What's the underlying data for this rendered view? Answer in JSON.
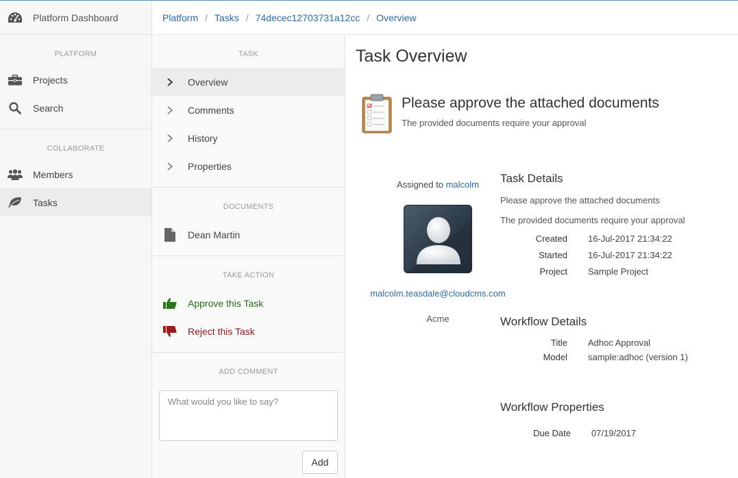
{
  "sidebar": {
    "brand": "Platform Dashboard",
    "section_platform": "PLATFORM",
    "projects": "Projects",
    "search": "Search",
    "section_collaborate": "COLLABORATE",
    "members": "Members",
    "tasks": "Tasks"
  },
  "breadcrumb": {
    "platform": "Platform",
    "tasks": "Tasks",
    "task_id": "74decec12703731a12cc",
    "overview": "Overview",
    "separator": "/"
  },
  "panel": {
    "section_task": "TASK",
    "overview": "Overview",
    "comments": "Comments",
    "history": "History",
    "properties": "Properties",
    "section_documents": "DOCUMENTS",
    "document_name": "Dean Martin",
    "section_action": "TAKE ACTION",
    "approve": "Approve this Task",
    "reject": "Reject this Task",
    "section_comment": "ADD COMMENT",
    "comment_placeholder": "What would you like to say?",
    "add_button": "Add"
  },
  "main": {
    "page_title": "Task Overview",
    "task_title": "Please approve the attached documents",
    "task_description": "The provided documents require your approval",
    "assigned_label": "Assigned to",
    "assignee": "malcolm",
    "email": "malcolm.teasdale@cloudcms.com",
    "company": "Acme",
    "task_details": {
      "heading": "Task Details",
      "line1": "Please approve the attached documents",
      "line2": "The provided documents require your approval",
      "created_label": "Created",
      "created": "16-Jul-2017 21:34:22",
      "started_label": "Started",
      "started": "16-Jul-2017 21:34:22",
      "project_label": "Project",
      "project": "Sample Project"
    },
    "workflow_details": {
      "heading": "Workflow Details",
      "title_label": "Title",
      "title": "Adhoc Approval",
      "model_label": "Model",
      "model": "sample:adhoc (version 1)"
    },
    "workflow_properties": {
      "heading": "Workflow Properties",
      "due_label": "Due Date",
      "due": "07/19/2017"
    }
  },
  "colors": {
    "link": "#2f6a9b",
    "approve": "#2a6b1b",
    "reject": "#8b1a1a"
  }
}
